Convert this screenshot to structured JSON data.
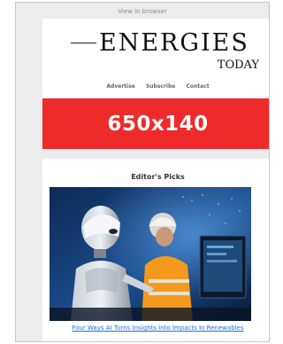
{
  "header": {
    "view_in_browser": "View in browser"
  },
  "logo": {
    "main": "ENERGIES",
    "sub": "TODAY"
  },
  "nav": [
    "Advertise",
    "Subscribe",
    "Contact"
  ],
  "ad": {
    "label": "650x140",
    "color": "#ee2a2a"
  },
  "picks": {
    "title": "Editor's Picks",
    "article_link": "Four Ways AI Turns Insights Into Impacts In Renewables"
  },
  "colors": {
    "link": "#1a73e8",
    "background": "#ececec"
  }
}
